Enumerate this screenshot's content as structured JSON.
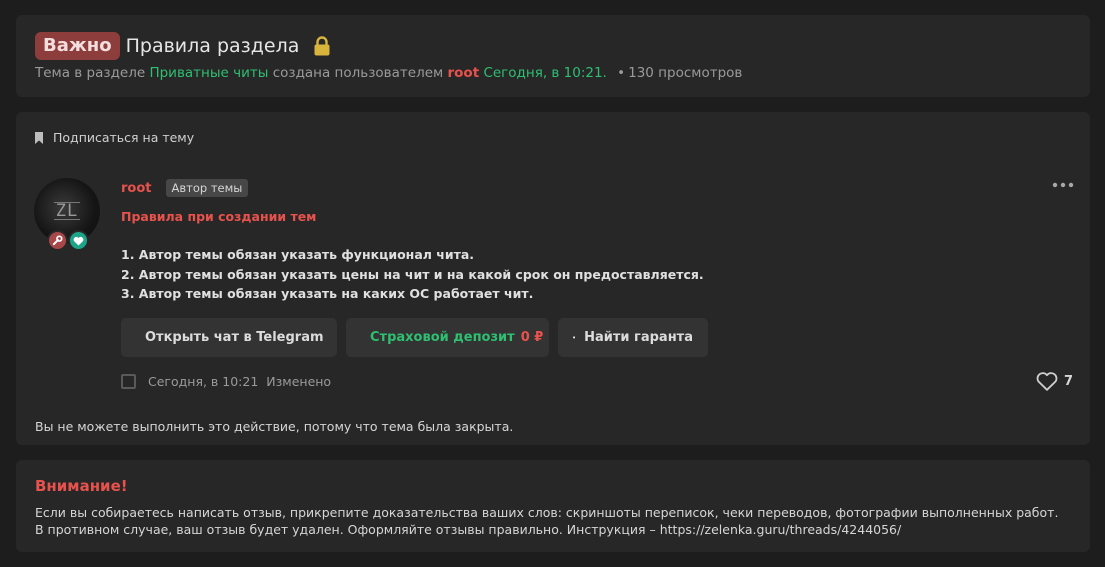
{
  "header": {
    "badge": "Важно",
    "title": "Правила раздела",
    "lock_icon": "lock-icon",
    "meta_prefix": "Тема в разделе",
    "section": "Приватные читы",
    "created_by": "создана пользователем",
    "author": "root",
    "date": "Сегодня, в 10:21.",
    "views": "130 просмотров"
  },
  "post": {
    "subscribe_label": "Подписаться на тему",
    "avatar_text": "ZL",
    "username": "root",
    "author_tag": "Автор темы",
    "rules_title": "Правила при создании тем",
    "rules": [
      "1. Автор темы обязан указать функционал чита.",
      "2. Автор темы обязан указать цены на чит и на какой срок он предоставляется.",
      "3. Автор темы обязан указать на каких ОС работает чит."
    ],
    "buttons": {
      "telegram": "Открыть чат в Telegram",
      "deposit": "Страховой депозит",
      "deposit_amount": "0 ₽",
      "guarantor": "Найти гаранта"
    },
    "timestamp": "Сегодня, в 10:21",
    "edited": "Изменено",
    "likes": "7",
    "closed_message": "Вы не можете выполнить это действие, потому что тема была закрыта."
  },
  "notice": {
    "title": "Внимание!",
    "line1": "Если вы собираетесь написать отзыв, прикрепите доказательства ваших слов: скриншоты переписок, чеки переводов, фотографии выполненных работ.",
    "line2": "В противном случае, ваш отзыв будет удален. Оформляйте отзывы правильно. Инструкция – https://zelenka.guru/threads/4244056/"
  },
  "colors": {
    "accent_red": "#e8524d",
    "accent_green": "#2fbf71",
    "badge_important": "#8e3d3d",
    "panel": "#272727",
    "background": "#1d1d1d"
  }
}
